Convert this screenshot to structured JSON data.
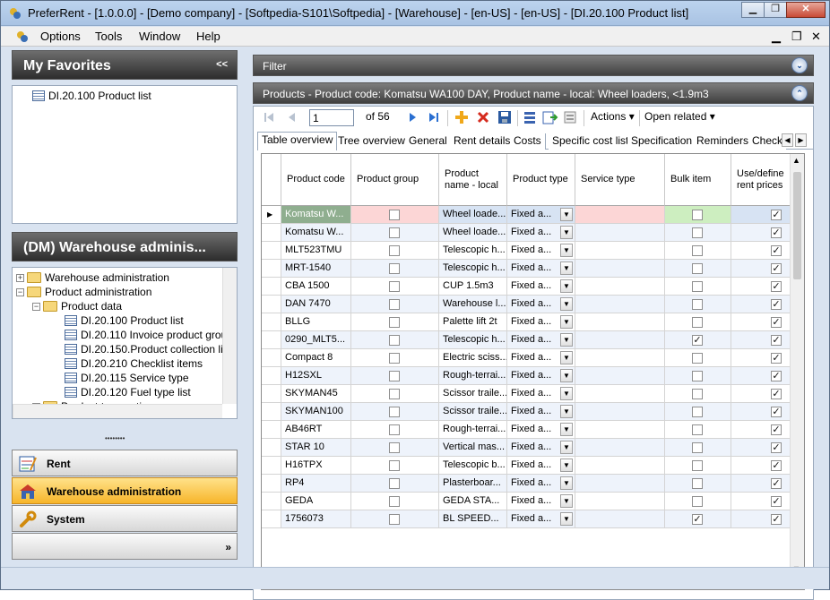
{
  "window": {
    "title": "PreferRent - [1.0.0.0] - [Demo company] - [Softpedia-S101\\Softpedia] - [Warehouse] - [en-US] - [en-US] - [DI.20.100 Product list]",
    "minimize": "▁",
    "restore": "❐",
    "close": "✕"
  },
  "menu": {
    "items": [
      "Options",
      "Tools",
      "Window",
      "Help"
    ],
    "mdi": {
      "minimize": "▁",
      "restore": "❐",
      "close": "✕"
    }
  },
  "favorites": {
    "title": "My Favorites",
    "collapse": "<<",
    "items": [
      "DI.20.100 Product list"
    ]
  },
  "module": {
    "title": "(DM) Warehouse adminis...",
    "tree": [
      {
        "label": "Warehouse administration",
        "pm": "+",
        "type": "folder"
      },
      {
        "label": "Product administration",
        "pm": "−",
        "type": "folder"
      },
      {
        "label": "Product data",
        "pm": "−",
        "type": "folder"
      },
      {
        "label": "DI.20.100 Product list",
        "type": "doc"
      },
      {
        "label": "DI.20.110 Invoice product group",
        "type": "doc"
      },
      {
        "label": "DI.20.150.Product collection list",
        "type": "doc"
      },
      {
        "label": "DI.20.210 Checklist items",
        "type": "doc"
      },
      {
        "label": "DI.20.115 Service type",
        "type": "doc"
      },
      {
        "label": "DI.20.120 Fuel type list",
        "type": "doc"
      },
      {
        "label": "Product transaction",
        "pm": "+",
        "type": "folder"
      }
    ]
  },
  "nav": {
    "grip": "••••••••",
    "items": [
      {
        "label": "Rent",
        "active": false
      },
      {
        "label": "Warehouse administration",
        "active": true
      },
      {
        "label": "System",
        "active": false
      }
    ],
    "more": "»"
  },
  "filter": {
    "label": "Filter",
    "toggle": "⌄"
  },
  "products": {
    "header": "Products - Product code: Komatsu WA100 DAY, Product name - local: Wheel loaders, <1.9m3",
    "toggle": "⌃",
    "page_current": "1",
    "page_total": "of 56",
    "actions_label": "Actions",
    "open_related_label": "Open related",
    "tabs": [
      "Table overview",
      "Tree overview",
      "General",
      "Rent details",
      "Costs",
      "Specific cost list",
      "Specification",
      "Reminders",
      "Check"
    ],
    "columns": [
      "Product code",
      "Product group",
      "Product name - local",
      "Product type",
      "Service type",
      "Bulk item",
      "Use/define rent prices"
    ],
    "rows": [
      {
        "code": "Komatsu W...",
        "name": "Wheel loade...",
        "type": "Fixed a...",
        "bulk": false,
        "rent": true
      },
      {
        "code": "Komatsu W...",
        "name": "Wheel loade...",
        "type": "Fixed a...",
        "bulk": false,
        "rent": true
      },
      {
        "code": "MLT523TMU",
        "name": "Telescopic h...",
        "type": "Fixed a...",
        "bulk": false,
        "rent": true
      },
      {
        "code": "MRT-1540",
        "name": "Telescopic h...",
        "type": "Fixed a...",
        "bulk": false,
        "rent": true
      },
      {
        "code": "CBA 1500",
        "name": "CUP 1.5m3",
        "type": "Fixed a...",
        "bulk": false,
        "rent": true
      },
      {
        "code": "DAN 7470",
        "name": "Warehouse l...",
        "type": "Fixed a...",
        "bulk": false,
        "rent": true
      },
      {
        "code": "BLLG",
        "name": "Palette lift 2t",
        "type": "Fixed a...",
        "bulk": false,
        "rent": true
      },
      {
        "code": "0290_MLT5...",
        "name": "Telescopic h...",
        "type": "Fixed a...",
        "bulk": true,
        "rent": true
      },
      {
        "code": "Compact 8",
        "name": "Electric sciss...",
        "type": "Fixed a...",
        "bulk": false,
        "rent": true
      },
      {
        "code": "H12SXL",
        "name": "Rough-terrai...",
        "type": "Fixed a...",
        "bulk": false,
        "rent": true
      },
      {
        "code": "SKYMAN45",
        "name": "Scissor traile...",
        "type": "Fixed a...",
        "bulk": false,
        "rent": true
      },
      {
        "code": "SKYMAN100",
        "name": "Scissor traile...",
        "type": "Fixed a...",
        "bulk": false,
        "rent": true
      },
      {
        "code": "AB46RT",
        "name": "Rough-terrai...",
        "type": "Fixed a...",
        "bulk": false,
        "rent": true
      },
      {
        "code": "STAR 10",
        "name": "Vertical mas...",
        "type": "Fixed a...",
        "bulk": false,
        "rent": true
      },
      {
        "code": "H16TPX",
        "name": "Telescopic b...",
        "type": "Fixed a...",
        "bulk": false,
        "rent": true
      },
      {
        "code": "RP4",
        "name": "Plasterboar...",
        "type": "Fixed a...",
        "bulk": false,
        "rent": true
      },
      {
        "code": "GEDA",
        "name": "GEDA STA...",
        "type": "Fixed a...",
        "bulk": false,
        "rent": true
      },
      {
        "code": "1756073",
        "name": "BL SPEED...",
        "type": "Fixed a...",
        "bulk": true,
        "rent": true
      }
    ]
  },
  "colors": {
    "selected_row_bg": "#d7e3f3",
    "pink_cell": "#fcd6d6",
    "green_cell": "#cdeec0"
  }
}
